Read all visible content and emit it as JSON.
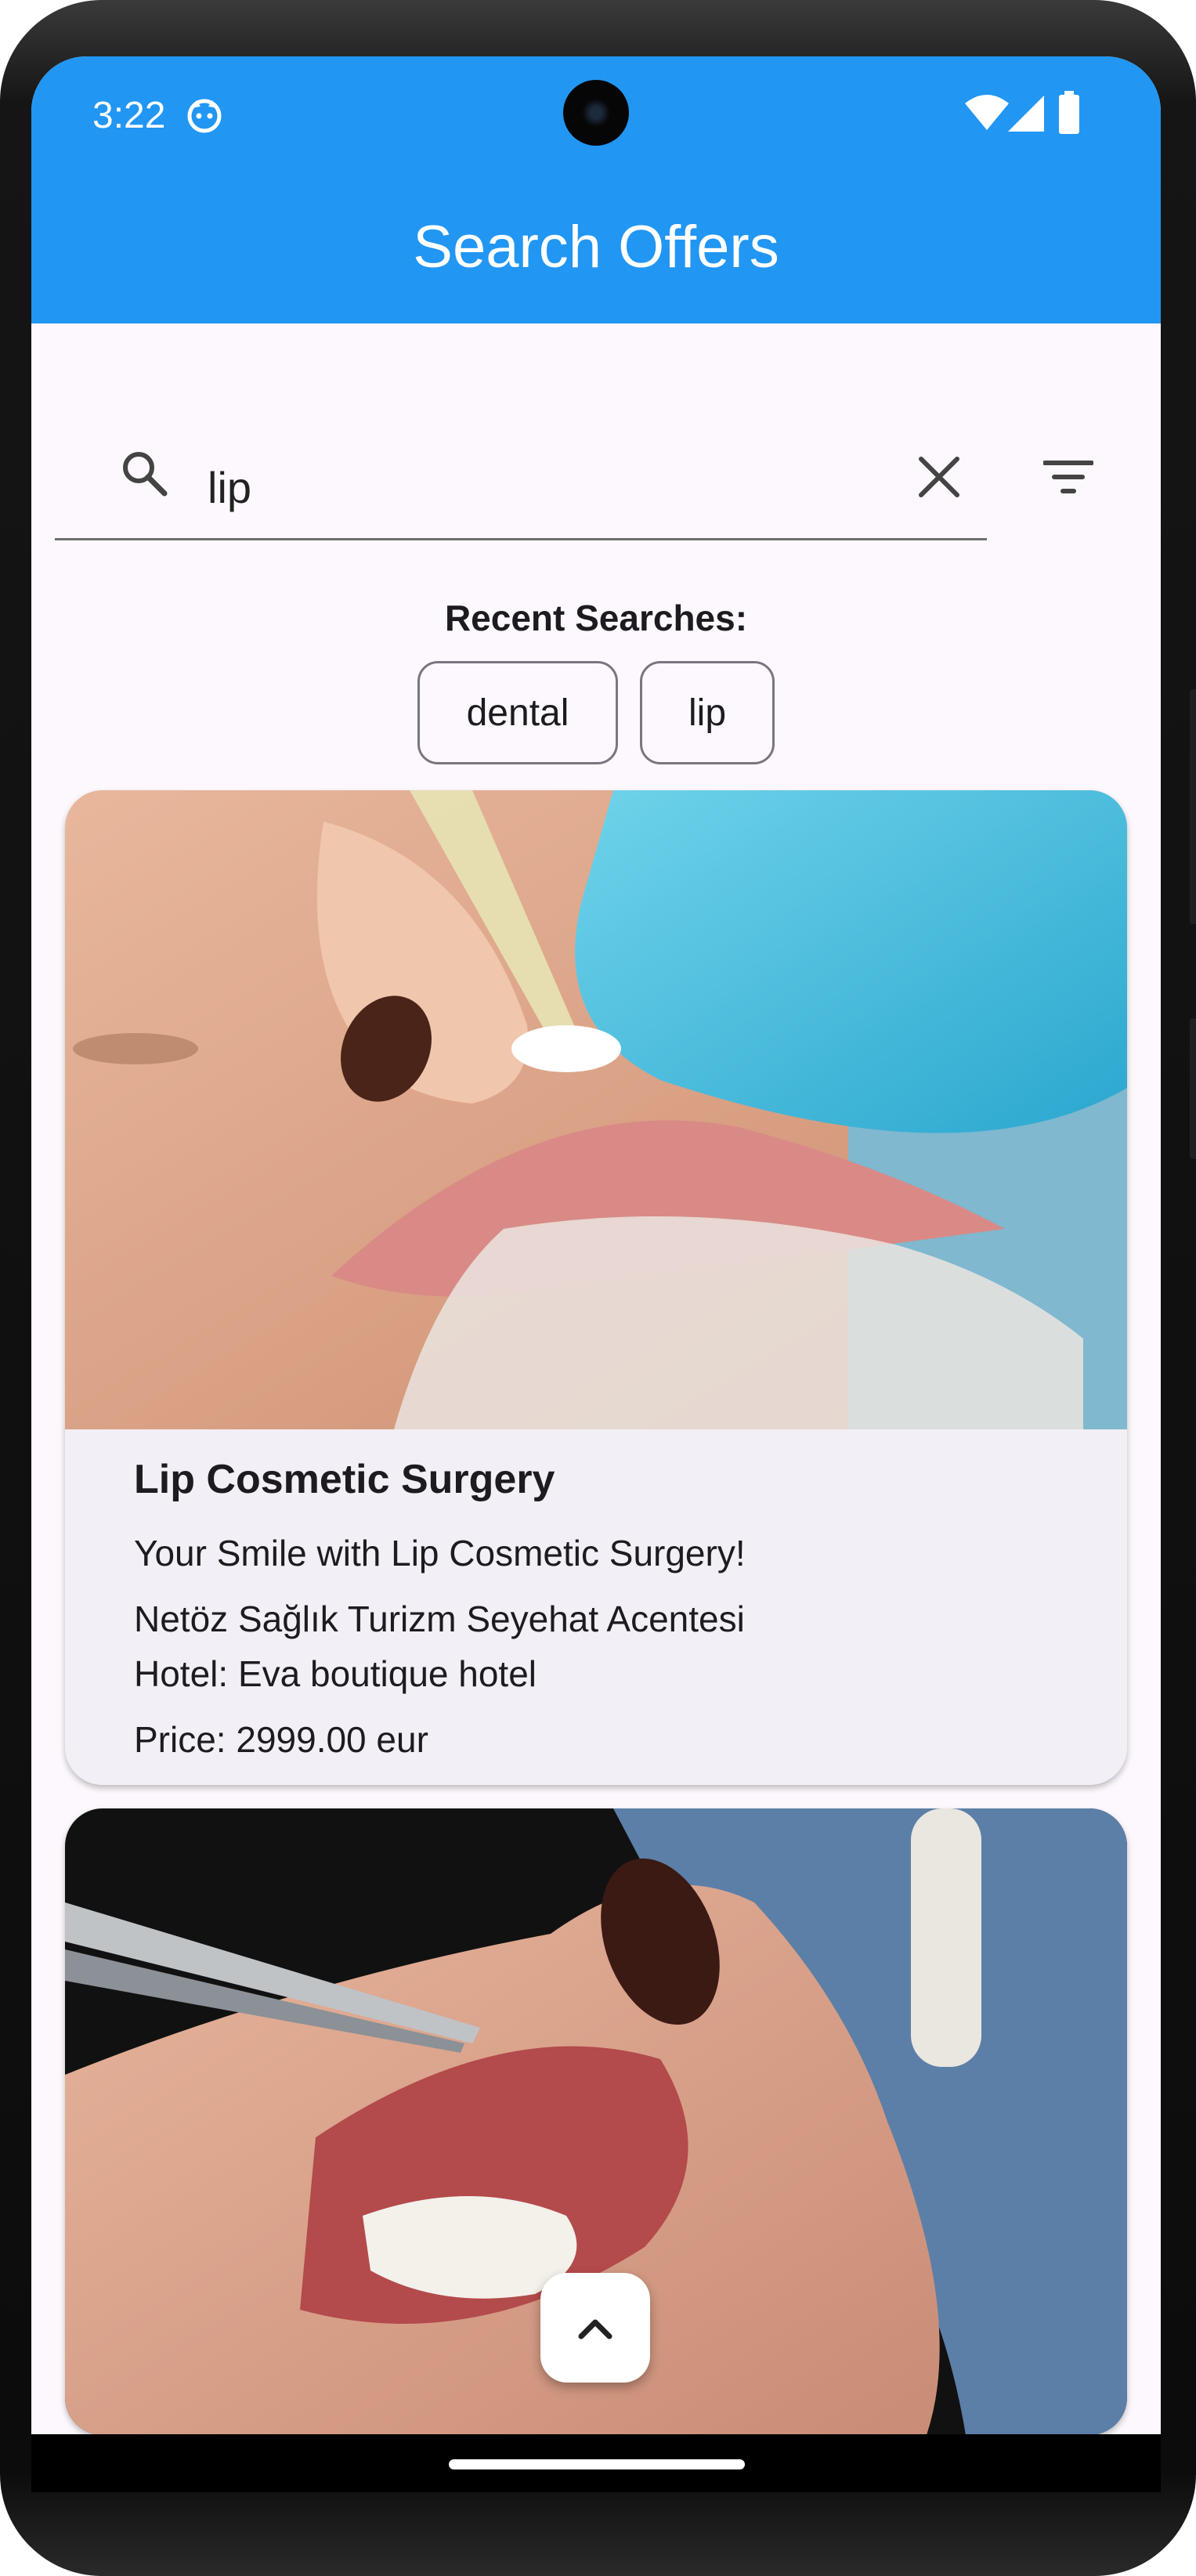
{
  "status_bar": {
    "time": "3:22"
  },
  "app_bar": {
    "title": "Search Offers"
  },
  "search": {
    "value": "lip"
  },
  "recent": {
    "label": "Recent Searches:",
    "chips": [
      "dental",
      "lip"
    ]
  },
  "offers": [
    {
      "title": "Lip Cosmetic Surgery",
      "subtitle": "Your Smile with Lip Cosmetic Surgery!",
      "agency": "Netöz Sağlık Turizm Seyehat Acentesi",
      "hotel": "Hotel: Eva boutique hotel",
      "price": "Price:  2999.00 eur"
    }
  ],
  "colors": {
    "app_bar": "#2196f3",
    "background": "#fdf8fd",
    "card": "#f3eff6",
    "chip_border": "#7a757f"
  },
  "icons": [
    "face-icon",
    "wifi-icon",
    "signal-icon",
    "battery-icon",
    "search-icon",
    "close-icon",
    "filter-icon",
    "chevron-up-icon"
  ]
}
